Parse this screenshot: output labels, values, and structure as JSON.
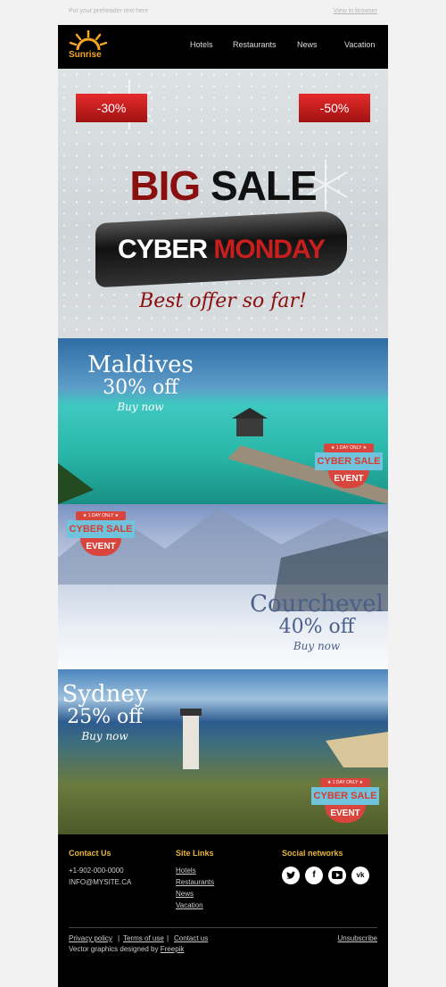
{
  "preheader": {
    "text": "Put your preheader text here",
    "view_link": "View in browser"
  },
  "header": {
    "brand": "Sunrise",
    "nav": [
      "Hotels",
      "Restaurants",
      "News",
      "Vacation"
    ]
  },
  "hero": {
    "discount_left": "-30%",
    "discount_right": "-50%",
    "big": "BIG",
    "sale": "SALE",
    "cyber": "CYBER",
    "monday": "MONDAY",
    "tagline": "Best offer so far!"
  },
  "badge": {
    "top": "★ 1 DAY ONLY ★",
    "middle": "CYBER SALE",
    "bottom": "EVENT"
  },
  "destinations": [
    {
      "name": "Maldives",
      "offer": "30% off",
      "cta": "Buy now"
    },
    {
      "name": "Courchevel",
      "offer": "40% off",
      "cta": "Buy now"
    },
    {
      "name": "Sydney",
      "offer": "25% off",
      "cta": "Buy now"
    }
  ],
  "footer": {
    "contact_title": "Contact Us",
    "phone": "+1-902-000-0000",
    "email": "INFO@MYSITE.CA",
    "links_title": "Site Links",
    "links": [
      "Hotels",
      "Restaurants",
      "News",
      "Vacation"
    ],
    "social_title": "Social networks",
    "privacy": "Privacy policy",
    "terms": "Terms of use",
    "contact": "Contact us",
    "sep": "|",
    "unsubscribe": "Unsubscribe",
    "credit_prefix": "Vector graphics designed by",
    "credit_link": "Freepik"
  }
}
